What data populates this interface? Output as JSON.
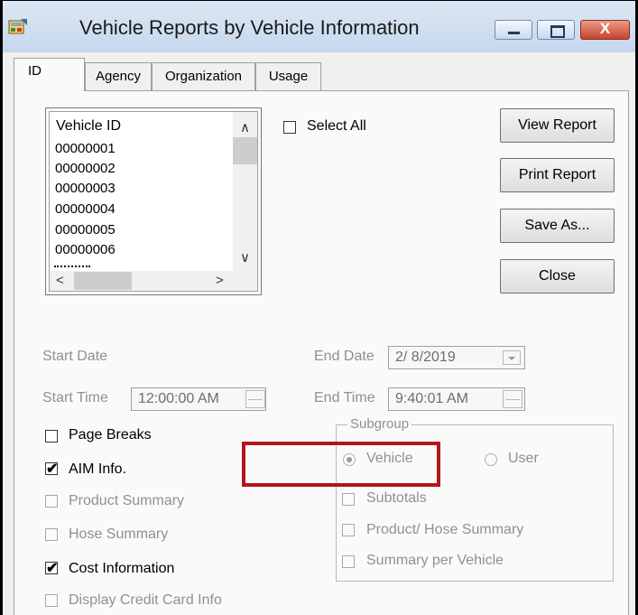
{
  "window": {
    "title": "Vehicle Reports by Vehicle Information"
  },
  "tabs": [
    "ID",
    "Agency",
    "Organization",
    "Usage"
  ],
  "vehicle_list": {
    "header": "Vehicle ID",
    "rows": [
      "00000001",
      "00000002",
      "00000003",
      "00000004",
      "00000005",
      "00000006"
    ]
  },
  "select_all": {
    "label": "Select All",
    "checked": false
  },
  "buttons": {
    "view_report": "View Report",
    "print_report": "Print Report",
    "save_as": "Save As...",
    "close": "Close"
  },
  "dates": {
    "start_date_label": "Start Date",
    "end_date_label": "End Date",
    "end_date_value": "2/ 8/2019",
    "start_time_label": "Start Time",
    "start_time_value": "12:00:00 AM",
    "end_time_label": "End Time",
    "end_time_value": "9:40:01 AM"
  },
  "options": {
    "page_breaks": {
      "label": "Page Breaks",
      "checked": false
    },
    "aim_info": {
      "label": "AIM Info.",
      "checked": true
    },
    "product_summary": {
      "label": "Product Summary",
      "checked": false
    },
    "hose_summary": {
      "label": "Hose Summary",
      "checked": false
    },
    "cost_information": {
      "label": "Cost Information",
      "checked": true
    },
    "display_credit_card_info": {
      "label": "Display Credit Card Info",
      "checked": false
    }
  },
  "subgroup": {
    "title": "Subgroup",
    "vehicle_label": "Vehicle",
    "user_label": "User",
    "selected": "Vehicle",
    "subtotals": "Subtotals",
    "product_hose_summary": "Product/ Hose Summary",
    "summary_per_vehicle": "Summary per Vehicle"
  },
  "symbols": {
    "check": "✔",
    "scroll_up": "∧",
    "scroll_down": "∨",
    "scroll_left": "<",
    "scroll_right": ">",
    "close_x": "X"
  },
  "colors": {
    "highlight": "#b3151a",
    "titlebar": "#c6d7ec",
    "disabled_text": "#909090"
  }
}
